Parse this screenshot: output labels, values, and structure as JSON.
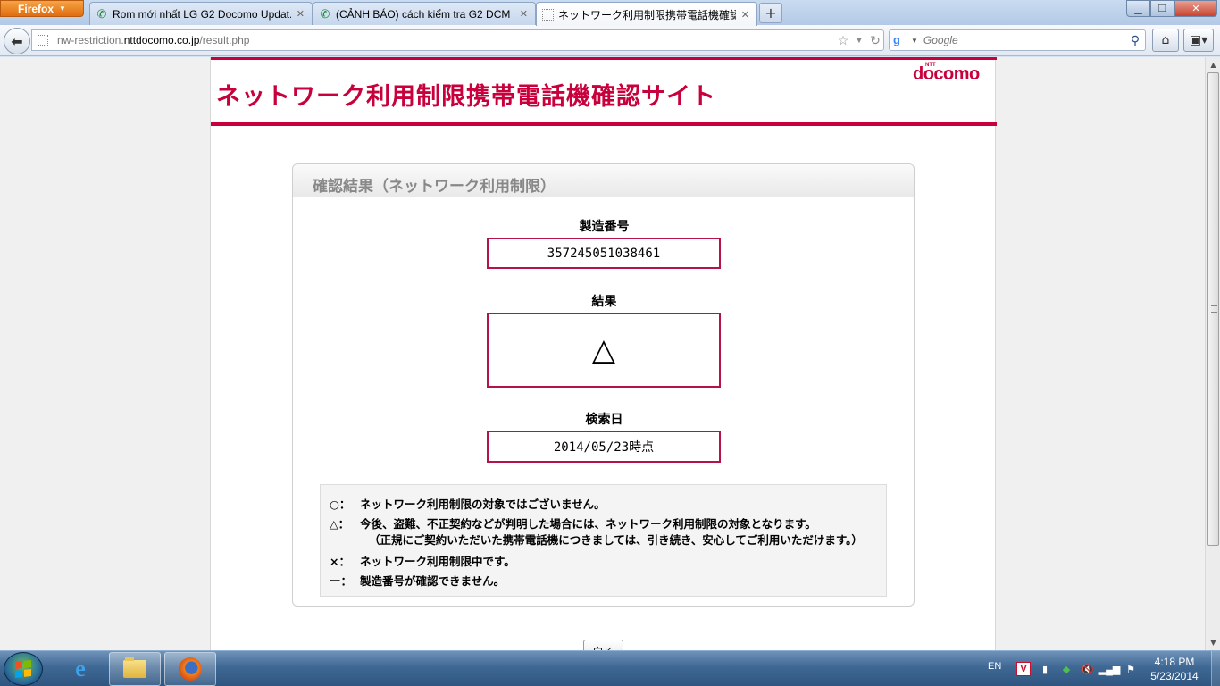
{
  "browser": {
    "menu_label": "Firefox",
    "tabs": [
      {
        "label": "Rom mới nhất LG G2 Docomo Updat...",
        "icon": "phone-icon",
        "active": false
      },
      {
        "label": "(CẢNH BÁO) cách kiểm tra G2 DCM ...",
        "icon": "phone-icon",
        "active": false
      },
      {
        "label": "ネットワーク利用制限携帯電話機確認...",
        "icon": "blank-page-icon",
        "active": true
      }
    ],
    "url_prefix": "nw-restriction.",
    "url_domain": "nttdocomo.co.jp",
    "url_path": "/result.php",
    "search_engine": "Google",
    "search_placeholder": "Google"
  },
  "page": {
    "site_title": "ネットワーク利用制限携帯電話機確認サイト",
    "logo": "docomo",
    "logo_small": "NTT",
    "result_heading": "確認結果（ネットワーク利用制限）",
    "imei_label": "製造番号",
    "imei_value": "357245051038461",
    "result_label": "結果",
    "result_value": "△",
    "date_label": "検索日",
    "date_value": "2014/05/23時点",
    "legend": [
      {
        "symbol": "○：",
        "text": "ネットワーク利用制限の対象ではございません。"
      },
      {
        "symbol": "△：",
        "text": "今後、盗難、不正契約などが判明した場合には、ネットワーク利用制限の対象となります。",
        "continuation": "（正規にご契約いただいた携帯電話機につきましては、引き続き、安心してご利用いただけます。）"
      },
      {
        "symbol": "×：",
        "text": "ネットワーク利用制限中です。"
      },
      {
        "symbol": "ー：",
        "text": "製造番号が確認できません。"
      }
    ],
    "back_button": "戻る",
    "brand_color": "#c8003c"
  },
  "taskbar": {
    "language": "EN",
    "time": "4:18 PM",
    "date": "5/23/2014",
    "pinned": [
      "internet-explorer-icon",
      "file-explorer-icon",
      "firefox-icon"
    ]
  }
}
